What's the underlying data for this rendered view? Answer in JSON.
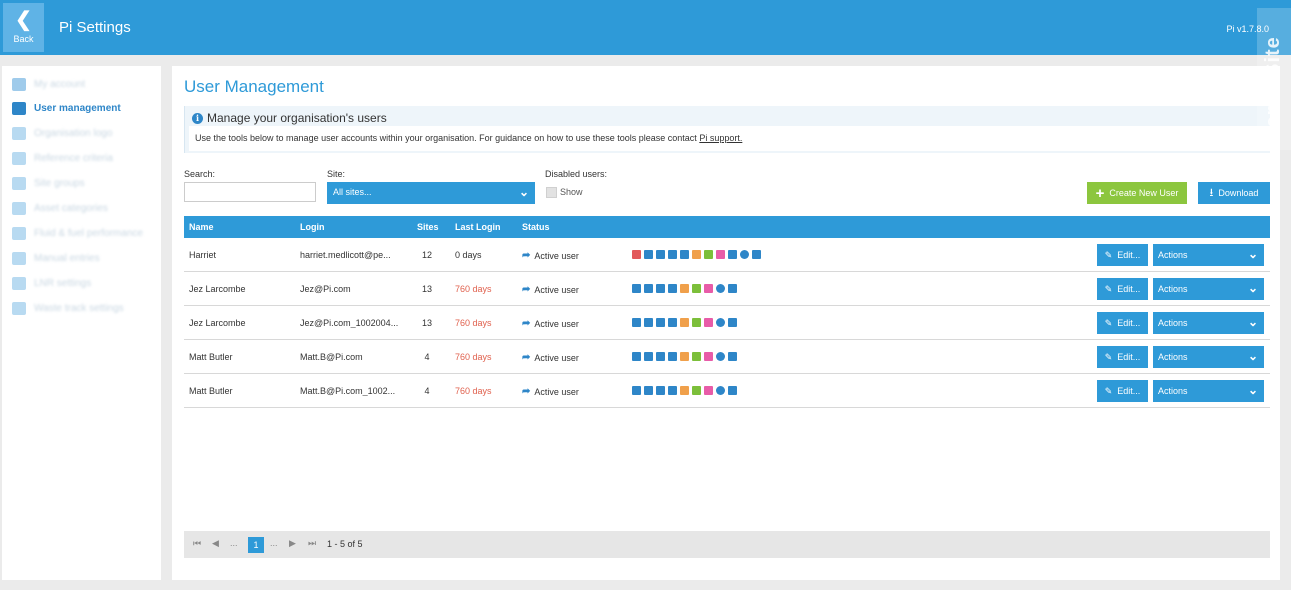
{
  "header": {
    "back_label": "Back",
    "title": "Pi Settings",
    "version": "Pi v1.7.8.0",
    "demo_badge": "Demo Site"
  },
  "sidebar": {
    "items": [
      {
        "label": "My account",
        "icon": "user-icon",
        "active": false
      },
      {
        "label": "User management",
        "icon": "users-icon",
        "active": true
      },
      {
        "label": "Organisation logo",
        "icon": "image-icon",
        "active": false
      },
      {
        "label": "Reference criteria",
        "icon": "criteria-icon",
        "active": false
      },
      {
        "label": "Site groups",
        "icon": "group-icon",
        "active": false
      },
      {
        "label": "Asset categories",
        "icon": "category-icon",
        "active": false
      },
      {
        "label": "Fluid & fuel performance",
        "icon": "fuel-icon",
        "active": false
      },
      {
        "label": "Manual entries",
        "icon": "manual-icon",
        "active": false
      },
      {
        "label": "LNR settings",
        "icon": "settings-icon",
        "active": false
      },
      {
        "label": "Waste track settings",
        "icon": "waste-icon",
        "active": false
      }
    ]
  },
  "main": {
    "title": "User Management",
    "info": {
      "heading": "Manage your organisation's users",
      "body": "Use the tools below to manage user accounts within your organisation. For guidance on how to use these tools please contact ",
      "link": "Pi support."
    },
    "filters": {
      "search_label": "Search:",
      "search_value": "",
      "site_label": "Site:",
      "site_value": "All sites...",
      "disabled_label": "Disabled users:",
      "show_label": "Show"
    },
    "buttons": {
      "create": "Create New User",
      "download": "Download"
    },
    "table": {
      "headers": {
        "name": "Name",
        "login": "Login",
        "sites": "Sites",
        "last_login": "Last Login",
        "status": "Status"
      },
      "rows": [
        {
          "name": "Harriet",
          "login": "harriet.medlicott@pe...",
          "sites": "12",
          "last_login": "0 days",
          "status": "Active user",
          "edit": "Edit...",
          "actions": "Actions"
        },
        {
          "name": "Jez Larcombe",
          "login": "Jez@Pi.com",
          "sites": "13",
          "last_login": "760 days",
          "status": "Active user",
          "edit": "Edit...",
          "actions": "Actions"
        },
        {
          "name": "Jez Larcombe",
          "login": "Jez@Pi.com_1002004...",
          "sites": "13",
          "last_login": "760 days",
          "status": "Active user",
          "edit": "Edit...",
          "actions": "Actions"
        },
        {
          "name": "Matt Butler",
          "login": "Matt.B@Pi.com",
          "sites": "4",
          "last_login": "760 days",
          "status": "Active user",
          "edit": "Edit...",
          "actions": "Actions"
        },
        {
          "name": "Matt Butler",
          "login": "Matt.B@Pi.com_1002...",
          "sites": "4",
          "last_login": "760 days",
          "status": "Active user",
          "edit": "Edit...",
          "actions": "Actions"
        }
      ],
      "module_icons_first": [
        "#e2595b",
        "#2e86c8",
        "#2e86c8",
        "#2e86c8",
        "#2e86c8",
        "#f0a04b",
        "#7cbf3a",
        "#e85ca8",
        "#2e86c8",
        "#2e86c8",
        "#2e86c8"
      ],
      "module_icons_other": [
        "#2e86c8",
        "#2e86c8",
        "#2e86c8",
        "#2e86c8",
        "#f0a04b",
        "#7cbf3a",
        "#e85ca8",
        "#2e86c8",
        "#2e86c8"
      ]
    },
    "pager": {
      "current_page": "1",
      "ellipsis": "...",
      "info": "1 - 5 of 5"
    }
  },
  "colors": {
    "primary": "#2e9ad8",
    "create": "#8cc63e",
    "stale_login": "#e0614e"
  }
}
